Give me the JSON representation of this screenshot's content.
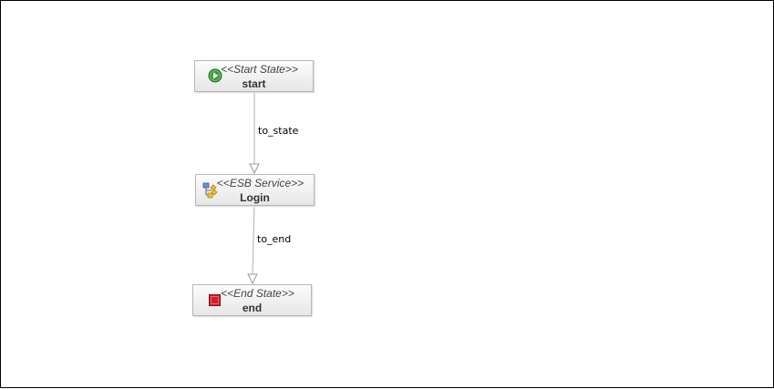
{
  "nodes": {
    "start": {
      "stereotype": "<<Start State>>",
      "name": "start",
      "icon": "play-icon",
      "icon_color": "#3d9a3d"
    },
    "login": {
      "stereotype": "<<ESB Service>>",
      "name": "Login",
      "icon": "esb-service-icon",
      "icon_color": "#e8c13a"
    },
    "end": {
      "stereotype": "<<End State>>",
      "name": "end",
      "icon": "stop-icon",
      "icon_color": "#d0202a"
    }
  },
  "edges": {
    "to_state": {
      "label": "to_state"
    },
    "to_end": {
      "label": "to_end"
    }
  },
  "colors": {
    "edge": "#b0b0b0",
    "node_border": "#b7b7b7"
  }
}
